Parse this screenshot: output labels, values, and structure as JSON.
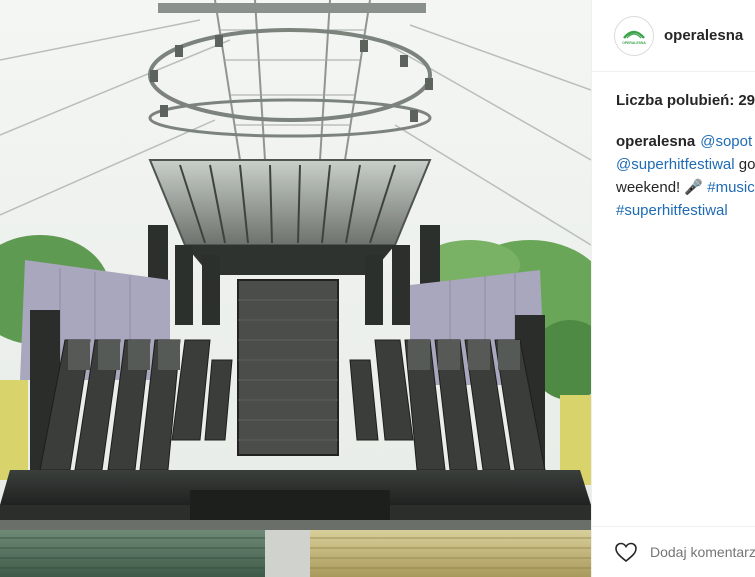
{
  "post": {
    "username": "operalesna",
    "avatar_icon": "operalesna-logo-icon",
    "avatar_logo_text": "OPERALESNA",
    "likes_label": "Liczba polubień:",
    "likes_count": "29",
    "caption": {
      "author": "operalesna",
      "line1_mention_a": "@sopot",
      "line1_mention_b": "@",
      "line2_mention": "@superhitfestiwal",
      "line2_text": " got",
      "line3_text": "weekend! ",
      "line3_emoji": "🎤",
      "line3_hashtag": "#music",
      "line3_tail": " #",
      "line4_hashtag": "#superhitfestiwal"
    },
    "like_icon": "heart-icon",
    "comment_placeholder": "Dodaj komentarz..."
  },
  "colors": {
    "link": "#1f6bb5",
    "text": "#262626",
    "muted": "#a5a5a5",
    "logo_green": "#3aa34a"
  }
}
